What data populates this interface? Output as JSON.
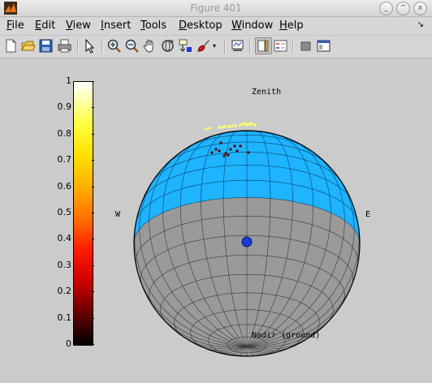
{
  "window": {
    "title": "Figure 401",
    "controls": [
      "_",
      "^",
      "x"
    ]
  },
  "menu": [
    {
      "label": "File",
      "key": "F"
    },
    {
      "label": "Edit",
      "key": "E"
    },
    {
      "label": "View",
      "key": "V"
    },
    {
      "label": "Insert",
      "key": "I"
    },
    {
      "label": "Tools",
      "key": "T"
    },
    {
      "label": "Desktop",
      "key": "D"
    },
    {
      "label": "Window",
      "key": "W"
    },
    {
      "label": "Help",
      "key": "H"
    }
  ],
  "menu_dock_glyph": "↘",
  "toolbar_icons": [
    "new-figure",
    "open-file",
    "save",
    "print",
    "select-arrow",
    "zoom-in",
    "zoom-out",
    "pan",
    "rotate-3d",
    "data-cursor",
    "brush",
    "link-plot",
    "colorbar",
    "legend",
    "hide-plot-tools",
    "show-plot-tools"
  ],
  "colorbar": {
    "ticks": [
      "1",
      "0.9",
      "0.8",
      "0.7",
      "0.6",
      "0.5",
      "0.4",
      "0.3",
      "0.2",
      "0.1",
      "0"
    ],
    "colormap": "hot",
    "min": 0,
    "max": 1
  },
  "sphere_labels": {
    "top": "Zenith",
    "bottom": "Nadir (ground)",
    "left": "W",
    "right": "E"
  },
  "colors": {
    "sky": "#1eb4ff",
    "ground": "#9a9a9a",
    "grid": "#0a3f6e",
    "observer": "#1a3ad8"
  }
}
